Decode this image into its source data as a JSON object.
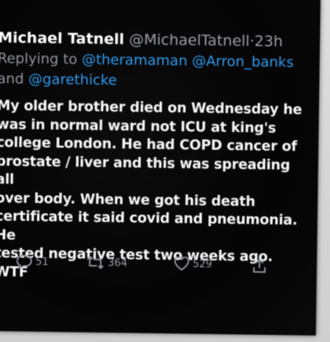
{
  "tweet": {
    "name": "Michael Tatnell",
    "handle": "@MichaelTatnell",
    "separator": "·",
    "time": "23h",
    "replying_to_label": "Replying to",
    "mentions": [
      "@theramaman",
      "@Arron_banks",
      "@garethicke"
    ],
    "and_label": "and",
    "body_lines": [
      "My older brother died on Wednesday he",
      "was in normal ward not ICU at king's",
      "college London. He had COPD cancer of",
      "prostate / liver and this was spreading all",
      "over body. When we got his death",
      "certificate it said covid and pneumonia. He",
      "tested negative test two weeks ago. WTF"
    ],
    "actions": {
      "reply_count": "51",
      "retweet_count": "364",
      "like_count": "529"
    }
  },
  "icons": {
    "reply": "reply-icon",
    "retweet": "retweet-icon",
    "like": "heart-icon",
    "share": "share-icon"
  },
  "colors": {
    "background": "#050505",
    "text": "#f7f7f7",
    "muted": "#9aa0a6",
    "link": "#2f9bef"
  }
}
